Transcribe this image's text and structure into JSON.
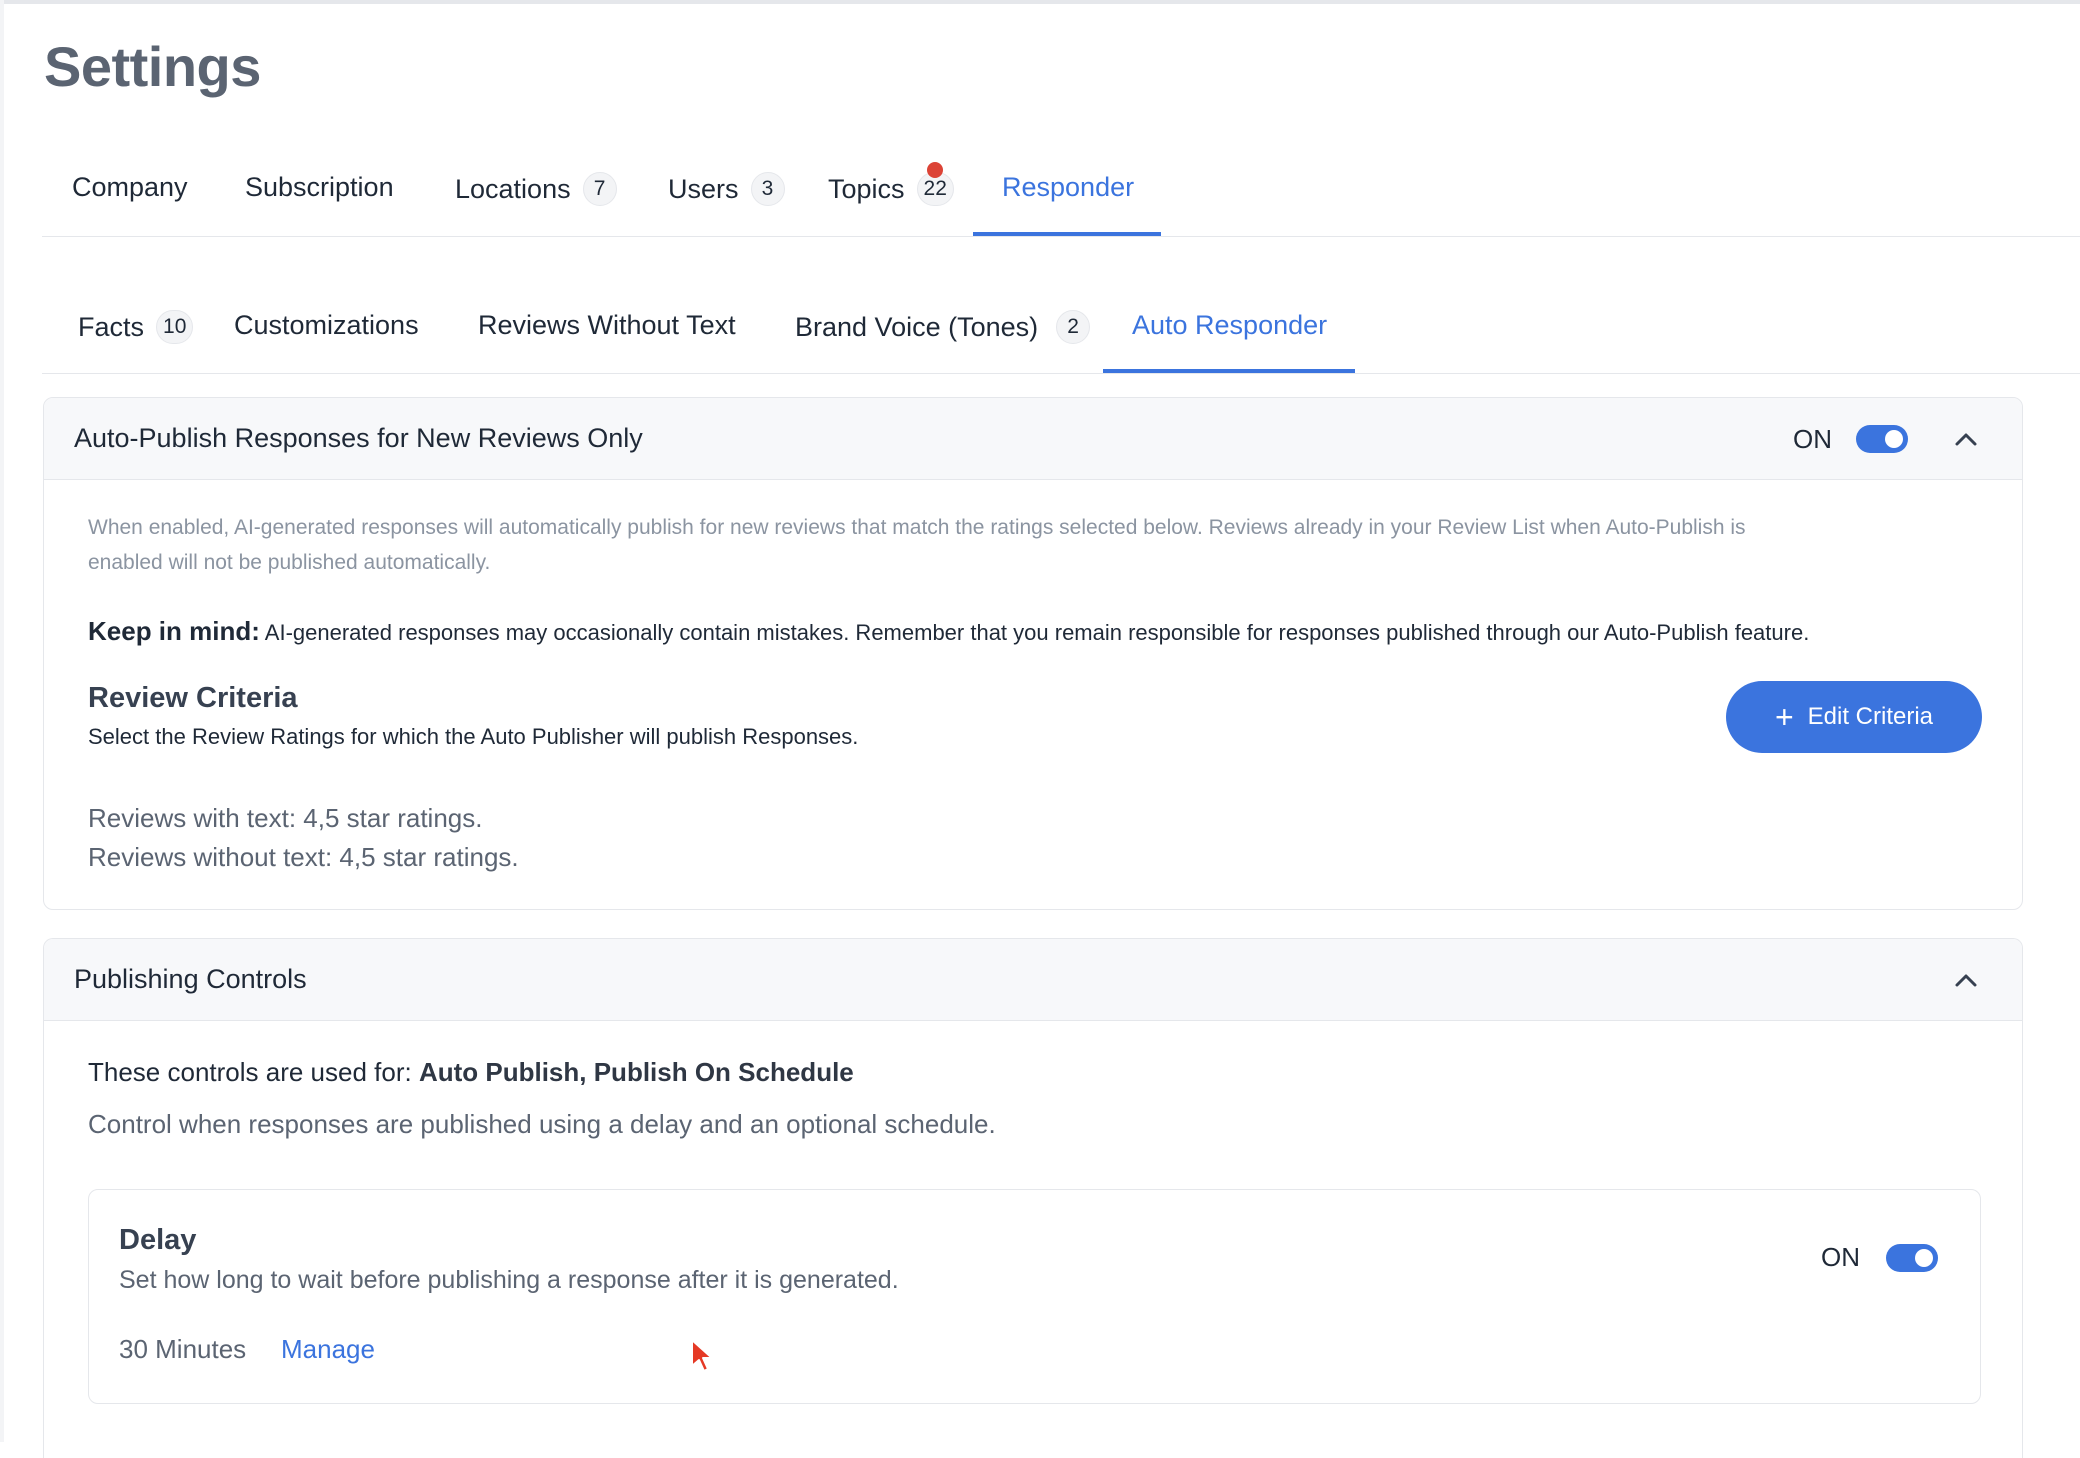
{
  "page": {
    "title": "Settings"
  },
  "main_tabs": [
    {
      "label": "Company"
    },
    {
      "label": "Subscription"
    },
    {
      "label": "Locations",
      "count": "7"
    },
    {
      "label": "Users",
      "count": "3"
    },
    {
      "label": "Topics",
      "count": "22",
      "alert": true
    },
    {
      "label": "Responder",
      "active": true
    }
  ],
  "sub_tabs": [
    {
      "label": "Facts",
      "count": "10"
    },
    {
      "label": "Customizations"
    },
    {
      "label": "Reviews Without Text"
    },
    {
      "label": "Brand Voice (Tones)",
      "count": "2"
    },
    {
      "label": "Auto Responder",
      "active": true
    }
  ],
  "auto_publish": {
    "title": "Auto-Publish Responses for New Reviews Only",
    "toggle_label": "ON",
    "toggle_on": true,
    "description_line1": "When enabled, AI-generated responses will automatically publish for new reviews that match the ratings selected below. Reviews already in your Review List when Auto-Publish is",
    "description_line2": "enabled will not be published automatically.",
    "keep_in_mind_label": "Keep in mind:",
    "keep_in_mind_text": " AI-generated responses may occasionally contain mistakes. Remember that you remain responsible for responses published through our Auto-Publish feature.",
    "criteria_title": "Review Criteria",
    "criteria_subtitle": "Select the Review Ratings for which the Auto Publisher will publish Responses.",
    "edit_button": "Edit Criteria",
    "with_text": "Reviews with text: 4,5 star ratings.",
    "without_text": "Reviews without text: 4,5 star ratings."
  },
  "publishing_controls": {
    "title": "Publishing Controls",
    "used_for_label": "These controls are used for: ",
    "used_for_value": "Auto Publish, Publish On Schedule",
    "description": "Control when responses are published using a delay and an optional schedule.",
    "delay": {
      "title": "Delay",
      "subtitle": "Set how long to wait before publishing a response after it is generated.",
      "value": "30 Minutes",
      "manage_link": "Manage",
      "toggle_label": "ON",
      "toggle_on": true
    }
  },
  "colors": {
    "accent": "#3b74de",
    "alert_dot": "#dc4336",
    "muted_text": "#8b94a1",
    "border": "#e5e7eb"
  },
  "icons": {
    "collapse": "chevron-up-icon",
    "add": "plus-icon",
    "pointer": "mouse-cursor-icon"
  }
}
